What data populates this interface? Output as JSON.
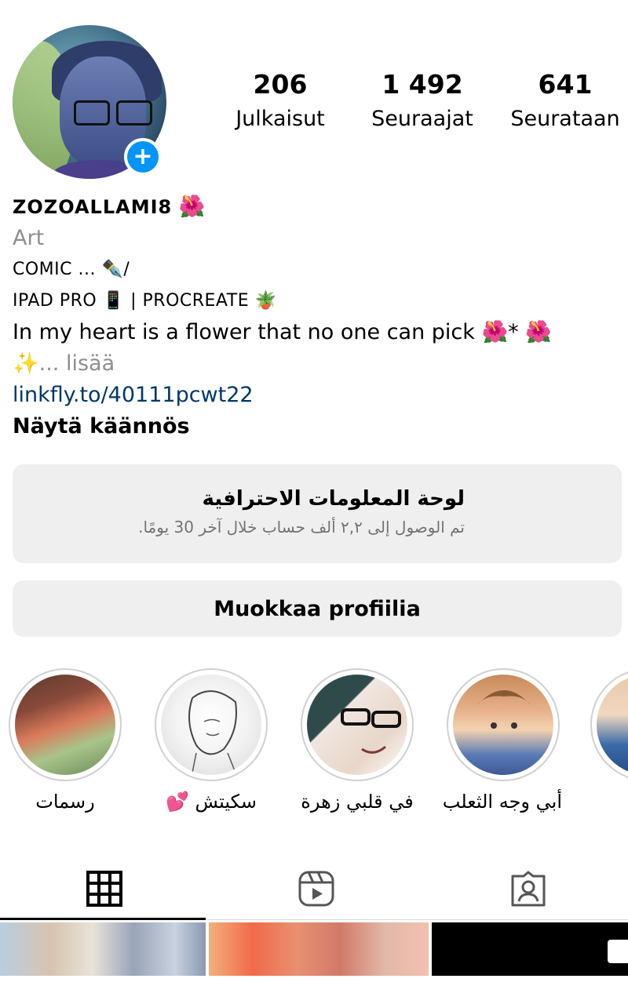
{
  "profile": {
    "username": "ZOZOALLAMI8",
    "username_emoji": "🌺",
    "category": "Art",
    "stats": [
      {
        "value": "206",
        "label": "Julkaisut"
      },
      {
        "value": "1 492",
        "label": "Seuraajat"
      },
      {
        "value": "641",
        "label": "Seurataan"
      }
    ],
    "bio": {
      "line1_text": "COMIC ...",
      "line1_emoji": "✒️",
      "line1_tail": "/",
      "line2_text_a": "IPAD PRO",
      "line2_emoji_a": "📱",
      "line2_text_b": "| PROCREATE",
      "line2_emoji_b": "🪴",
      "line3_text": "In my heart is a flower that no one can pick",
      "line3_emoji_a": "🌺",
      "line3_mid": "*",
      "line3_emoji_b": "🌺",
      "line4_emoji": "✨",
      "line4_more": "... lisää"
    },
    "link": "linkfly.to/40111pcwt22",
    "translate": "Näytä käännös"
  },
  "dashboard": {
    "title": "لوحة المعلومات الاحترافية",
    "subtitle": "تم الوصول إلى ٢,٢ ألف حساب خلال آخر 30 يومًا."
  },
  "edit_profile_label": "Muokkaa profiilia",
  "highlights": [
    {
      "label": "رسمات"
    },
    {
      "label": "سكيتش 💕"
    },
    {
      "label": "في قلبي زهرة"
    },
    {
      "label": "أبي وجه الثعلب"
    }
  ],
  "tabs": {
    "icons": [
      "grid-icon",
      "reels-icon",
      "tagged-icon"
    ]
  },
  "colors": {
    "accent": "#0095f6",
    "link": "#00376b",
    "muted": "#8e8e8e",
    "button_bg": "#efefef"
  }
}
